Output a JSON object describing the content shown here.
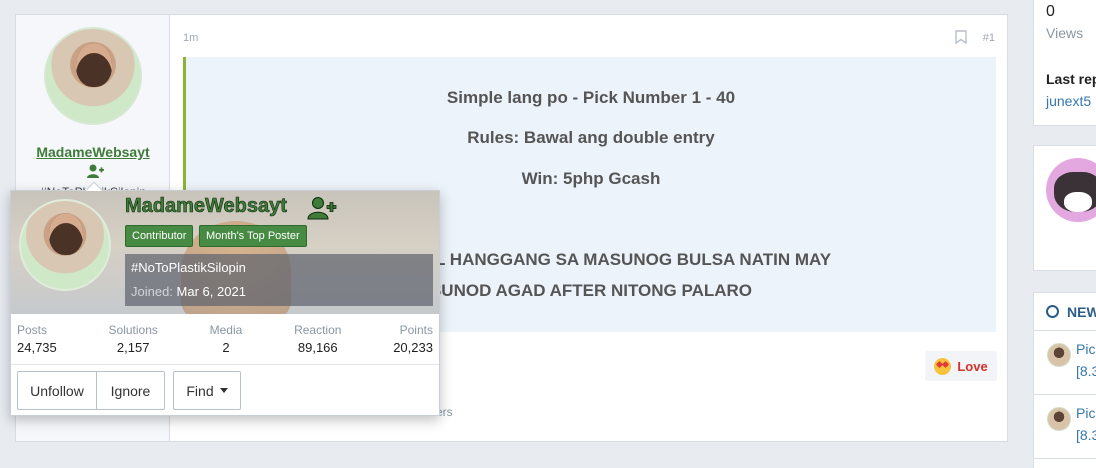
{
  "post": {
    "author_name": "MadameWebsayt",
    "author_signature": "#NoToPlastikSilopin",
    "time": "1m",
    "post_number": "#1",
    "content_lines": [
      "Simple lang po - Pick Number 1 - 40",
      "Rules: Bawal ang double entry",
      "Win: 5php Gcash",
      "AKO DAHIL HANGGANG SA MASUNOG BULSA NATIN MAY",
      "SUNOD AGAD AFTER NITONG PALARO"
    ],
    "reaction_label": "Love",
    "reaction_summary": "ers"
  },
  "sidebar": {
    "views_count": "0",
    "views_label": "Views",
    "last_reply_label": "Last rep",
    "last_reply_user": "junext5",
    "new_header": "NEW",
    "new_items": [
      {
        "title": "Pic",
        "sub": "[8.3"
      },
      {
        "title": "Pic",
        "sub": "[8.3"
      }
    ]
  },
  "member_tooltip": {
    "name": "MadameWebsayt",
    "badges": [
      "Contributor",
      "Month's Top Poster"
    ],
    "signature": "#NoToPlastikSilopin",
    "joined_label": "Joined:",
    "joined_date": "Mar 6, 2021",
    "stats": [
      {
        "label": "Posts",
        "value": "24,735"
      },
      {
        "label": "Solutions",
        "value": "2,157"
      },
      {
        "label": "Media",
        "value": "2"
      },
      {
        "label": "Reaction",
        "value": "89,166"
      },
      {
        "label": "Points",
        "value": "20,233"
      }
    ],
    "buttons": {
      "unfollow": "Unfollow",
      "ignore": "Ignore",
      "find": "Find"
    }
  },
  "colors": {
    "username_green": "#3f7c3a",
    "badge_green": "#478a44",
    "link_blue": "#3577ad",
    "love_red": "#d3302a",
    "post_accent": "#8ab530"
  }
}
